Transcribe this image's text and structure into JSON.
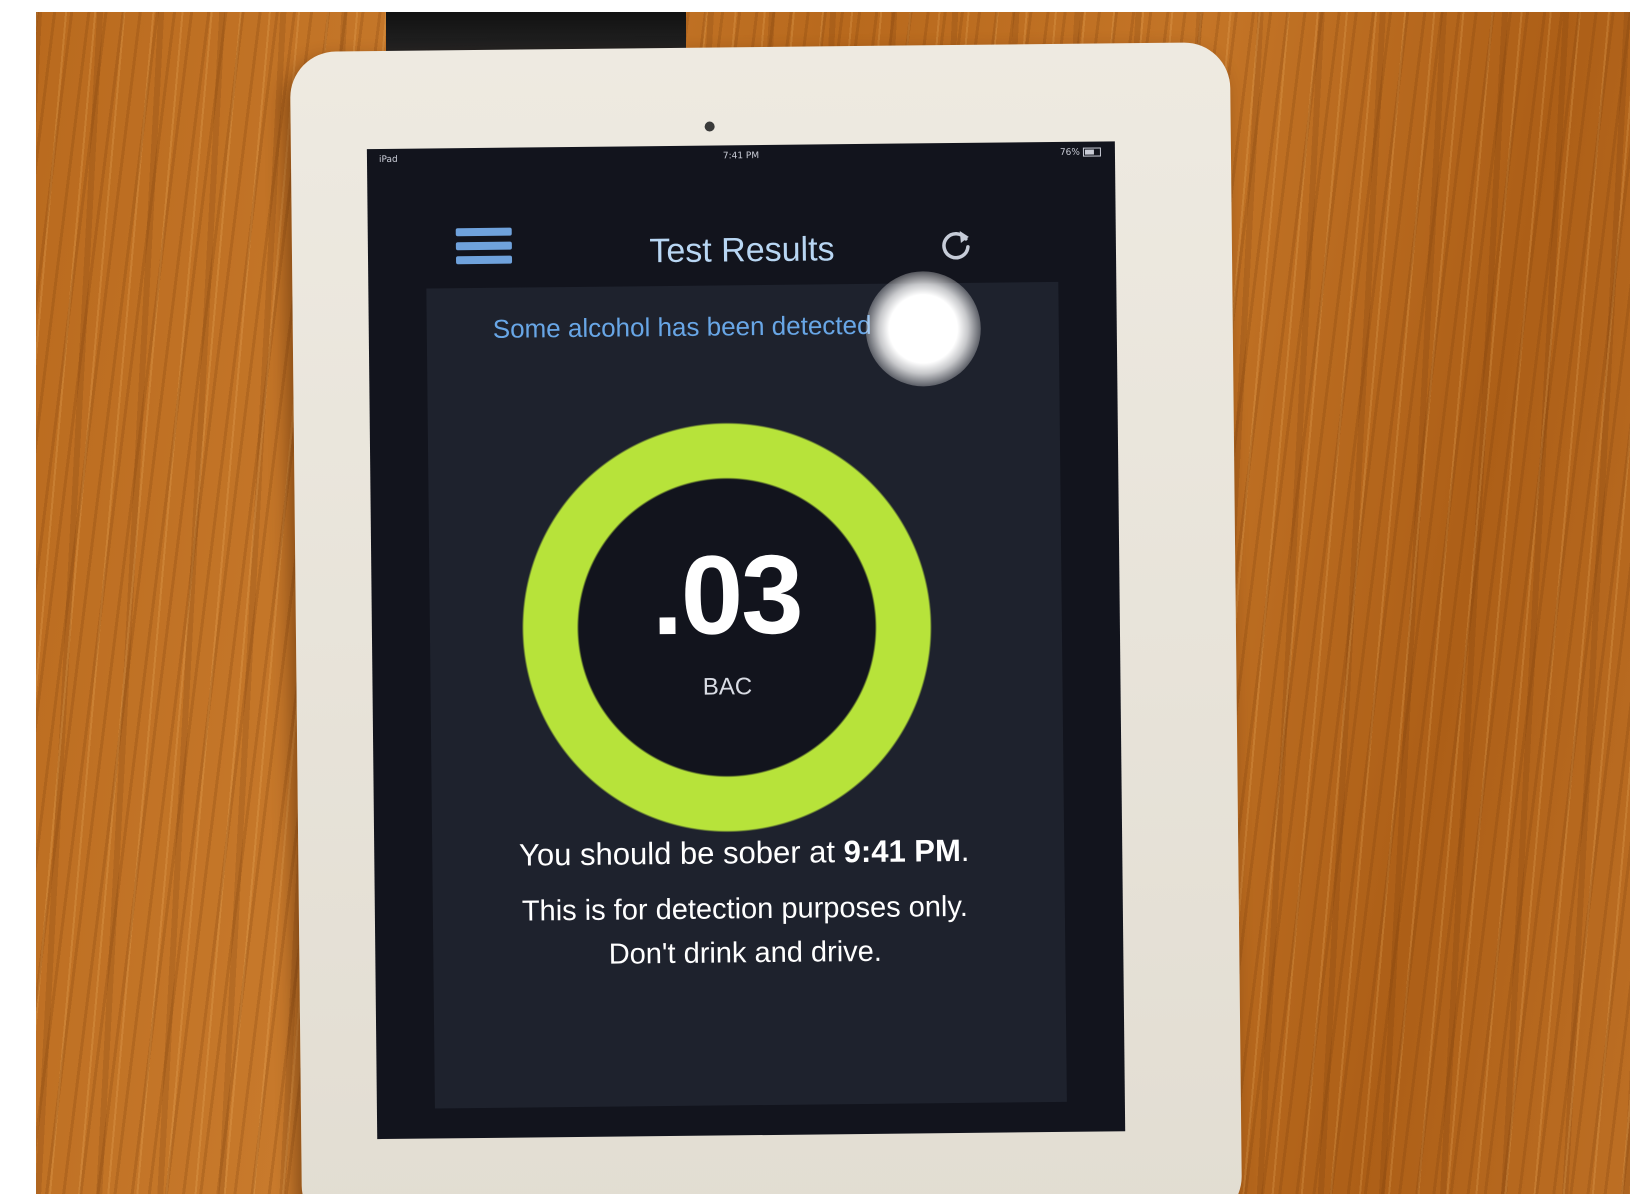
{
  "statusbar": {
    "carrier": "iPad",
    "time": "7:41 PM",
    "battery": "76%"
  },
  "navbar": {
    "title": "Test Results",
    "menu_icon": "hamburger-menu-icon",
    "refresh_icon": "refresh-icon"
  },
  "result": {
    "alert": "Some alcohol has been detected",
    "bac_value": ".03",
    "bac_label": "BAC",
    "sober_prefix": "You should be sober at ",
    "sober_time": "9:41 PM",
    "sober_suffix": ".",
    "disclaimer_line1": "This is for detection purposes only.",
    "disclaimer_line2": "Don't drink and drive."
  },
  "colors": {
    "ring": "#b7e33a",
    "accent_blue": "#68a6e6",
    "screen_bg": "#12141d"
  }
}
